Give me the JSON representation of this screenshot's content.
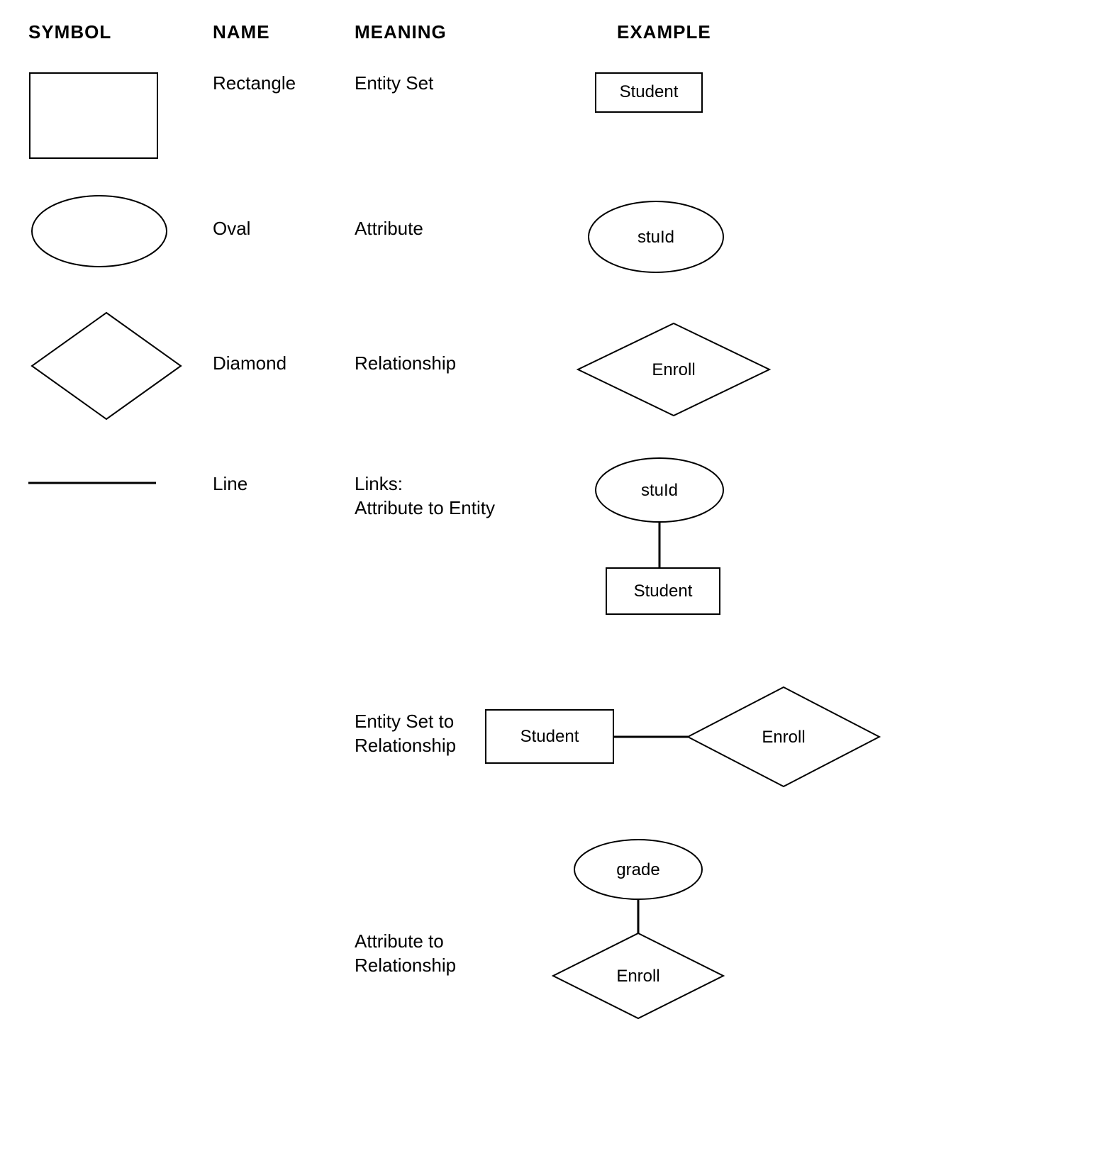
{
  "headers": {
    "symbol": "SYMBOL",
    "name": "NAME",
    "meaning": "MEANING",
    "example": "EXAMPLE"
  },
  "rows": [
    {
      "name": "Rectangle",
      "meaning": "Entity Set",
      "example_label": "Student"
    },
    {
      "name": "Oval",
      "meaning": "Attribute",
      "example_label": "stuId"
    },
    {
      "name": "Diamond",
      "meaning": "Relationship",
      "example_label": "Enroll"
    },
    {
      "name": "Line",
      "meaning": "Links:\nAttribute to Entity",
      "example_labels": {
        "top": "stuId",
        "bottom": "Student"
      }
    },
    {
      "meaning": "Entity Set to\nRelationship",
      "example_labels": {
        "left": "Student",
        "right": "Enroll"
      }
    },
    {
      "meaning": "Attribute to\nRelationship",
      "example_labels": {
        "top": "grade",
        "bottom": "Enroll"
      }
    }
  ]
}
